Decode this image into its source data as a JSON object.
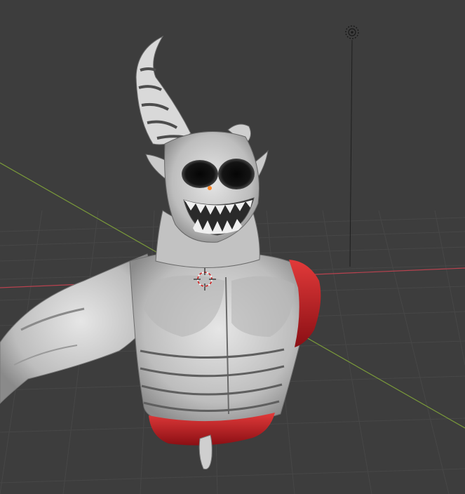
{
  "app": {
    "name": "3D Viewport"
  },
  "viewport": {
    "background_color": "#3d3d3d",
    "grid_color": "#4a4a4a",
    "x_axis_color": "#b8424f",
    "y_axis_color": "#7a9a3a"
  },
  "scene": {
    "model": {
      "name": "demon-bust",
      "skin_color": "#c8c8c8",
      "shadow_color": "#555555",
      "wound_color": "#d0202a",
      "eye_glow_color": "#ff8a2a"
    },
    "light_icon": "light-icon",
    "cursor_icon": "3d-cursor-icon"
  }
}
